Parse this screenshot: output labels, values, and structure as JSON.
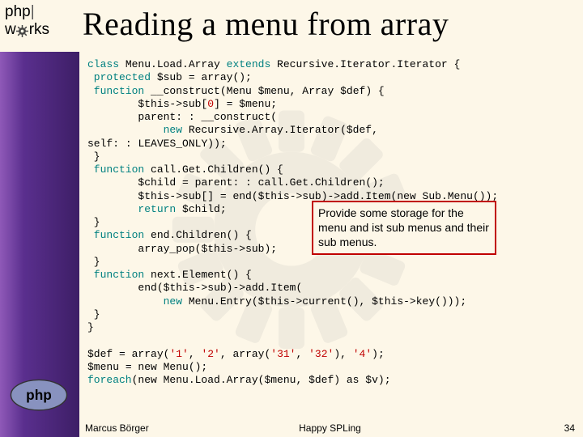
{
  "header": {
    "logo_top": "php",
    "logo_pipe": "|",
    "logo_bottom_w": "w",
    "logo_bottom_rest": "rks",
    "title": "Reading a menu from array"
  },
  "code": {
    "l1a": "class",
    "l1b": " Menu.Load.Array ",
    "l1c": "extends",
    "l1d": " Recursive.Iterator.Iterator {",
    "l2a": " protected ",
    "l2b": "$sub ",
    "l2c": "= array();",
    "l3a": " function ",
    "l3b": "__construct",
    "l3c": "(Menu ",
    "l3d": "$menu",
    "l3e": ", Array ",
    "l3f": "$def",
    "l3g": ") {",
    "l4a": "        $this",
    "l4b": "->",
    "l4c": "sub",
    "l4d": "[",
    "l4e": "0",
    "l4f": "] = ",
    "l4g": "$menu",
    "l4h": ";",
    "l5a": "        parent",
    "l5b": ": : ",
    "l5c": "__construct",
    "l5d": "(",
    "l6a": "            new ",
    "l6b": "Recursive.Array.Iterator",
    "l6c": "(",
    "l6d": "$def",
    "l6e": ",",
    "l7a": "self",
    "l7b": ": : ",
    "l7c": "LEAVES_ONLY",
    "l7d": "));",
    "l8": " }",
    "l9a": " function ",
    "l9b": "call.Get.Children",
    "l9c": "() {",
    "l10a": "        $child ",
    "l10b": "= ",
    "l10c": "parent",
    "l10d": ": : ",
    "l10e": "call.Get.Children",
    "l10f": "();",
    "l11a": "        $this",
    "l11b": "->",
    "l11c": "sub",
    "l11d": "[] = ",
    "l11e": "end",
    "l11f": "(",
    "l11g": "$this",
    "l11h": "->",
    "l11i": "sub",
    "l11j": ")->",
    "l11k": "add.Item",
    "l11l": "(new Sub.Menu());",
    "l12a": "        return ",
    "l12b": "$child",
    "l12c": ";",
    "l13": " }",
    "l14a": " function ",
    "l14b": "end.Children",
    "l14c": "() {",
    "l15a": "        array_pop",
    "l15b": "(",
    "l15c": "$this",
    "l15d": "->",
    "l15e": "sub",
    "l15f": ");",
    "l16": " }",
    "l17a": " function ",
    "l17b": "next.Element",
    "l17c": "() {",
    "l18a": "        end",
    "l18b": "(",
    "l18c": "$this",
    "l18d": "->",
    "l18e": "sub",
    "l18f": ")->",
    "l18g": "add.Item",
    "l18h": "(",
    "l19a": "            new ",
    "l19b": "Menu.Entry",
    "l19c": "(",
    "l19d": "$this",
    "l19e": "->",
    "l19f": "current",
    "l19g": "(), ",
    "l19h": "$this",
    "l19i": "->",
    "l19j": "key",
    "l19k": "()));",
    "l20": " }",
    "l21": "}",
    "l22": "",
    "l23a": "$def ",
    "l23b": "= array(",
    "l23c": "'1'",
    "l23d": ", ",
    "l23e": "'2'",
    "l23f": ", array(",
    "l23g": "'31'",
    "l23h": ", ",
    "l23i": "'32'",
    "l23j": "), ",
    "l23k": "'4'",
    "l23l": ");",
    "l24a": "$menu ",
    "l24b": "= new Menu();",
    "l25a": "foreach",
    "l25b": "(new Menu.Load.Array(",
    "l25c": "$menu",
    "l25d": ", ",
    "l25e": "$def",
    "l25f": ") as ",
    "l25g": "$v",
    "l25h": ");"
  },
  "callout": {
    "text": "Provide some storage for the menu and ist sub menus and their sub menus."
  },
  "footer": {
    "author": "Marcus Börger",
    "center": "Happy SPLing",
    "page": "34"
  }
}
